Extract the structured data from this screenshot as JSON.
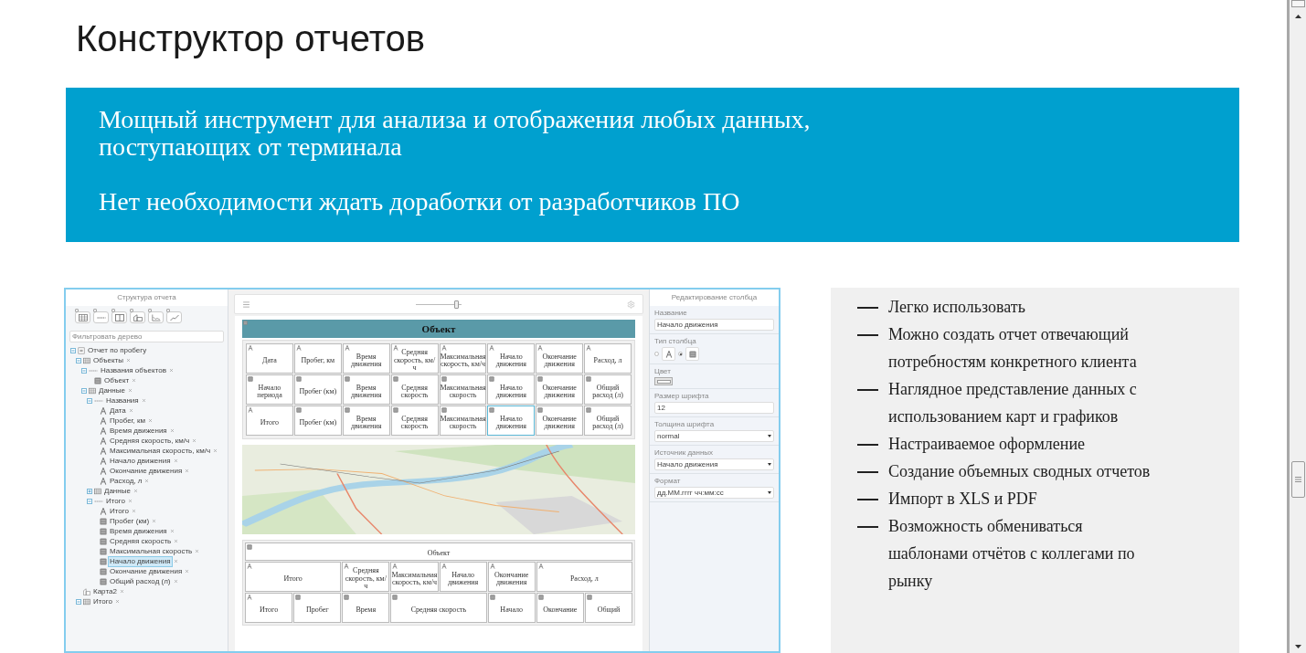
{
  "page_title": "Конструктор отчетов",
  "banner": {
    "paragraphs": [
      "Мощный инструмент для анализа и отображения любых данных, поступающих от терминала",
      "Нет необходимости ждать доработки от разработчиков ПО"
    ]
  },
  "report_builder": {
    "structure": {
      "title": "Структура отчета",
      "filter": {
        "placeholder": "Фильтровать дерево"
      },
      "tree": [
        {
          "label": "Отчет по пробегу",
          "kind": "report",
          "expanded": true,
          "selected": false,
          "children": [
            {
              "label": "Объекты",
              "kind": "table",
              "expanded": true,
              "selected": false,
              "children": [
                {
                  "label": "Названия объектов",
                  "kind": "row",
                  "expanded": true,
                  "selected": false,
                  "children": [
                    {
                      "label": "Объект",
                      "kind": "cell",
                      "selected": false
                    }
                  ]
                },
                {
                  "label": "Данные",
                  "kind": "table",
                  "expanded": true,
                  "selected": false,
                  "children": [
                    {
                      "label": "Названия",
                      "kind": "row",
                      "expanded": true,
                      "selected": false,
                      "children": [
                        {
                          "label": "Дата",
                          "kind": "text",
                          "selected": false
                        },
                        {
                          "label": "Пробег, км",
                          "kind": "text",
                          "selected": false
                        },
                        {
                          "label": "Время движения",
                          "kind": "text",
                          "selected": false
                        },
                        {
                          "label": "Средняя скорость, км/ч",
                          "kind": "text",
                          "selected": false
                        },
                        {
                          "label": "Максимальная скорость, км/ч",
                          "kind": "text",
                          "selected": false
                        },
                        {
                          "label": "Начало движения",
                          "kind": "text",
                          "selected": false
                        },
                        {
                          "label": "Окончание движения",
                          "kind": "text",
                          "selected": false
                        },
                        {
                          "label": "Расход, л",
                          "kind": "text",
                          "selected": false
                        }
                      ]
                    },
                    {
                      "label": "Данные",
                      "kind": "table",
                      "expanded": false,
                      "selected": false
                    },
                    {
                      "label": "Итого",
                      "kind": "row",
                      "expanded": true,
                      "selected": false,
                      "children": [
                        {
                          "label": "Итого",
                          "kind": "text",
                          "selected": false
                        },
                        {
                          "label": "Пробег (км)",
                          "kind": "cell",
                          "selected": false
                        },
                        {
                          "label": "Время движения",
                          "kind": "cell",
                          "selected": false
                        },
                        {
                          "label": "Средняя скорость",
                          "kind": "cell",
                          "selected": false
                        },
                        {
                          "label": "Максимальная скорость",
                          "kind": "cell",
                          "selected": false
                        },
                        {
                          "label": "Начало движения",
                          "kind": "cell",
                          "selected": true
                        },
                        {
                          "label": "Окончание движения",
                          "kind": "cell",
                          "selected": false
                        },
                        {
                          "label": "Общий расход (л)",
                          "kind": "cell",
                          "selected": false
                        }
                      ]
                    }
                  ]
                }
              ]
            },
            {
              "label": "Карта2",
              "kind": "map",
              "selected": false
            },
            {
              "label": "Итого",
              "kind": "table",
              "expanded": true,
              "selected": false
            }
          ]
        }
      ]
    },
    "canvas": {
      "zoom": {
        "level": 0.9
      },
      "table": {
        "title": "Объект",
        "rows": [
          [
            {
              "text": "Дата",
              "kind": "text",
              "selected": false
            },
            {
              "text": "Пробег, км",
              "kind": "text",
              "selected": false
            },
            {
              "text": "Время движения",
              "kind": "text",
              "selected": false
            },
            {
              "text": "Средняя скорость, км/ч",
              "kind": "text",
              "selected": false
            },
            {
              "text": "Максимальная скорость, км/ч",
              "kind": "text",
              "selected": false
            },
            {
              "text": "Начало движения",
              "kind": "text",
              "selected": false
            },
            {
              "text": "Окончание движения",
              "kind": "text",
              "selected": false
            },
            {
              "text": "Расход, л",
              "kind": "text",
              "selected": false
            }
          ],
          [
            {
              "text": "Начало периода",
              "kind": "cell",
              "selected": false
            },
            {
              "text": "Пробег (км)",
              "kind": "cell",
              "selected": false
            },
            {
              "text": "Время движения",
              "kind": "cell",
              "selected": false
            },
            {
              "text": "Средняя скорость",
              "kind": "cell",
              "selected": false
            },
            {
              "text": "Максимальная скорость",
              "kind": "cell",
              "selected": false
            },
            {
              "text": "Начало движения",
              "kind": "cell",
              "selected": false
            },
            {
              "text": "Окончание движения",
              "kind": "cell",
              "selected": false
            },
            {
              "text": "Общий расход (л)",
              "kind": "cell",
              "selected": false
            }
          ],
          [
            {
              "text": "Итого",
              "kind": "text",
              "selected": false
            },
            {
              "text": "Пробег (км)",
              "kind": "cell",
              "selected": false
            },
            {
              "text": "Время движения",
              "kind": "cell",
              "selected": false
            },
            {
              "text": "Средняя скорость",
              "kind": "cell",
              "selected": false
            },
            {
              "text": "Максимальная скорость",
              "kind": "cell",
              "selected": false
            },
            {
              "text": "Начало движения",
              "kind": "cell",
              "selected": true
            },
            {
              "text": "Окончание движения",
              "kind": "cell",
              "selected": false
            },
            {
              "text": "Общий расход (л)",
              "kind": "cell",
              "selected": false
            }
          ]
        ]
      },
      "summary_table": {
        "title": {
          "text": "Объект",
          "kind": "cell",
          "selected": false
        },
        "headings": [
          {
            "text": "Итого",
            "kind": "text",
            "selected": false
          },
          {
            "text": "Средняя скорость, км/ч",
            "kind": "text",
            "selected": false
          },
          {
            "text": "Максимальная скорость, км/ч",
            "kind": "text",
            "selected": false
          },
          {
            "text": "Начало движения",
            "kind": "text",
            "selected": false
          },
          {
            "text": "Окончание движения",
            "kind": "text",
            "selected": false
          },
          {
            "text": "Расход, л",
            "kind": "text",
            "selected": false
          }
        ],
        "totals": [
          {
            "text": "Итого",
            "kind": "text",
            "selected": false
          },
          {
            "text": "Пробег",
            "kind": "cell",
            "selected": false
          },
          {
            "text": "Время",
            "kind": "cell",
            "selected": false
          },
          {
            "text": "Средняя скорость",
            "kind": "cell",
            "selected": false
          },
          {
            "text": "Начало",
            "kind": "cell",
            "selected": false
          },
          {
            "text": "Окончание",
            "kind": "cell",
            "selected": false
          },
          {
            "text": "Общий",
            "kind": "cell",
            "selected": false
          }
        ]
      }
    },
    "column_editor": {
      "title": "Редактирование столбца",
      "fields": [
        {
          "label": "Название",
          "kind": "input",
          "value": "Начало движения"
        },
        {
          "label": "Тип столбца",
          "kind": "radio",
          "options": [
            {
              "kind": "text",
              "selected": false
            },
            {
              "kind": "cell",
              "selected": true
            }
          ]
        },
        {
          "label": "Цвет",
          "kind": "color",
          "color": "#ffffff"
        },
        {
          "label": "Размер шрифта",
          "kind": "input",
          "value": "12"
        },
        {
          "label": "Толщина шрифта",
          "kind": "select",
          "value": "normal"
        },
        {
          "label": "Источник данных",
          "kind": "select",
          "value": "Начало движения"
        },
        {
          "label": "Формат",
          "kind": "select",
          "value": "дд.ММ.гггг чч:мм:сс"
        }
      ]
    }
  },
  "features": [
    "Легко использовать",
    "Можно создать отчет отвечающий потребностям конкретного клиента",
    "Наглядное представление данных с использованием карт и графиков",
    "Настраиваемое оформление",
    "Создание объемных сводных отчетов",
    "Импорт в XLS и PDF",
    "Возможность обмениваться шаблонами отчётов с коллегами по рынку"
  ]
}
